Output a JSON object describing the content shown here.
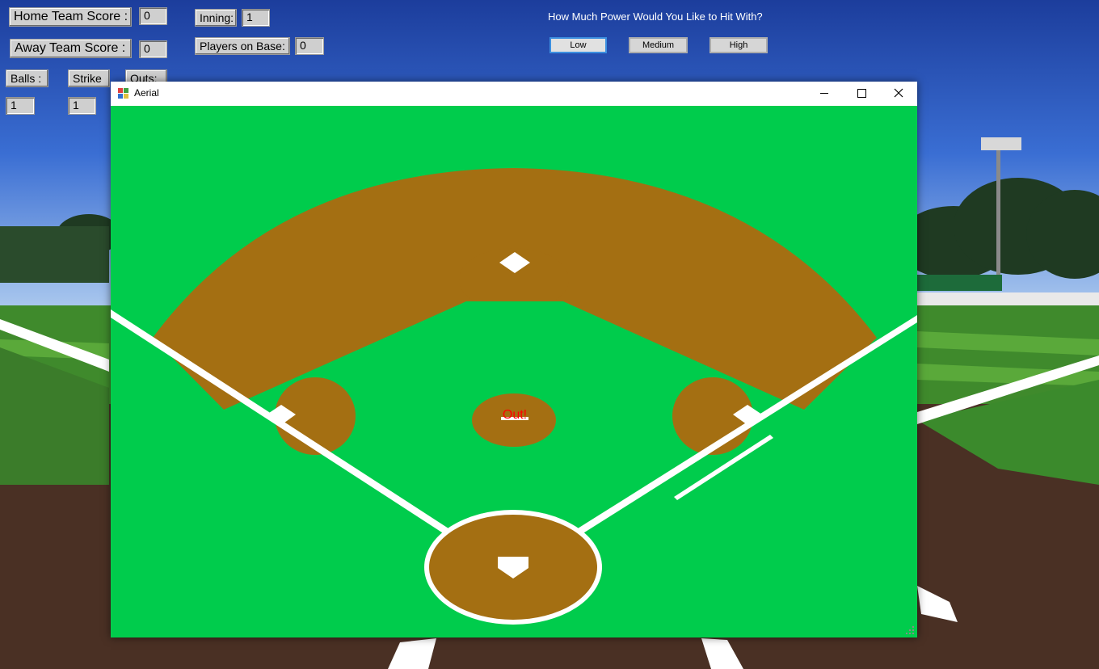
{
  "scoreboard": {
    "home_label": "Home Team Score :",
    "home_value": "0",
    "away_label": "Away Team Score :",
    "away_value": "0",
    "inning_label": "Inning:",
    "inning_value": "1",
    "players_label": "Players on Base:",
    "players_value": "0",
    "balls_label": "Balls :",
    "balls_value": "1",
    "strike_label": "Strike",
    "strike_value": "1",
    "outs_label": "Outs:"
  },
  "power": {
    "question": "How Much Power Would You Like to Hit With?",
    "options": [
      "Low",
      "Medium",
      "High"
    ],
    "selected": "Low"
  },
  "window": {
    "title": "Aerial"
  },
  "field": {
    "status": "Out!",
    "colors": {
      "grass": "#00cc4c",
      "dirt": "#a46f12",
      "lines": "#ffffff",
      "status": "#ff0000"
    }
  }
}
